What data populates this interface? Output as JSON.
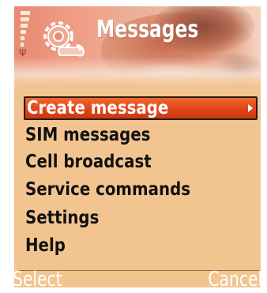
{
  "header": {
    "title": "Messages",
    "icon": "messages-gear-wrench-icon",
    "signal_icon": "signal-strength-icon",
    "antenna_icon": "antenna-icon"
  },
  "menu": {
    "items": [
      {
        "label": "Create message",
        "selected": true,
        "has_submenu": true
      },
      {
        "label": "SIM messages"
      },
      {
        "label": "Cell broadcast"
      },
      {
        "label": "Service commands"
      },
      {
        "label": "Settings"
      },
      {
        "label": "Help"
      }
    ]
  },
  "softkeys": {
    "left": "Select",
    "right": "Cancel"
  },
  "colors": {
    "background": "#f2c590",
    "highlight": "#e0431b",
    "text": "#111111",
    "softkey_text": "#ffffff"
  }
}
